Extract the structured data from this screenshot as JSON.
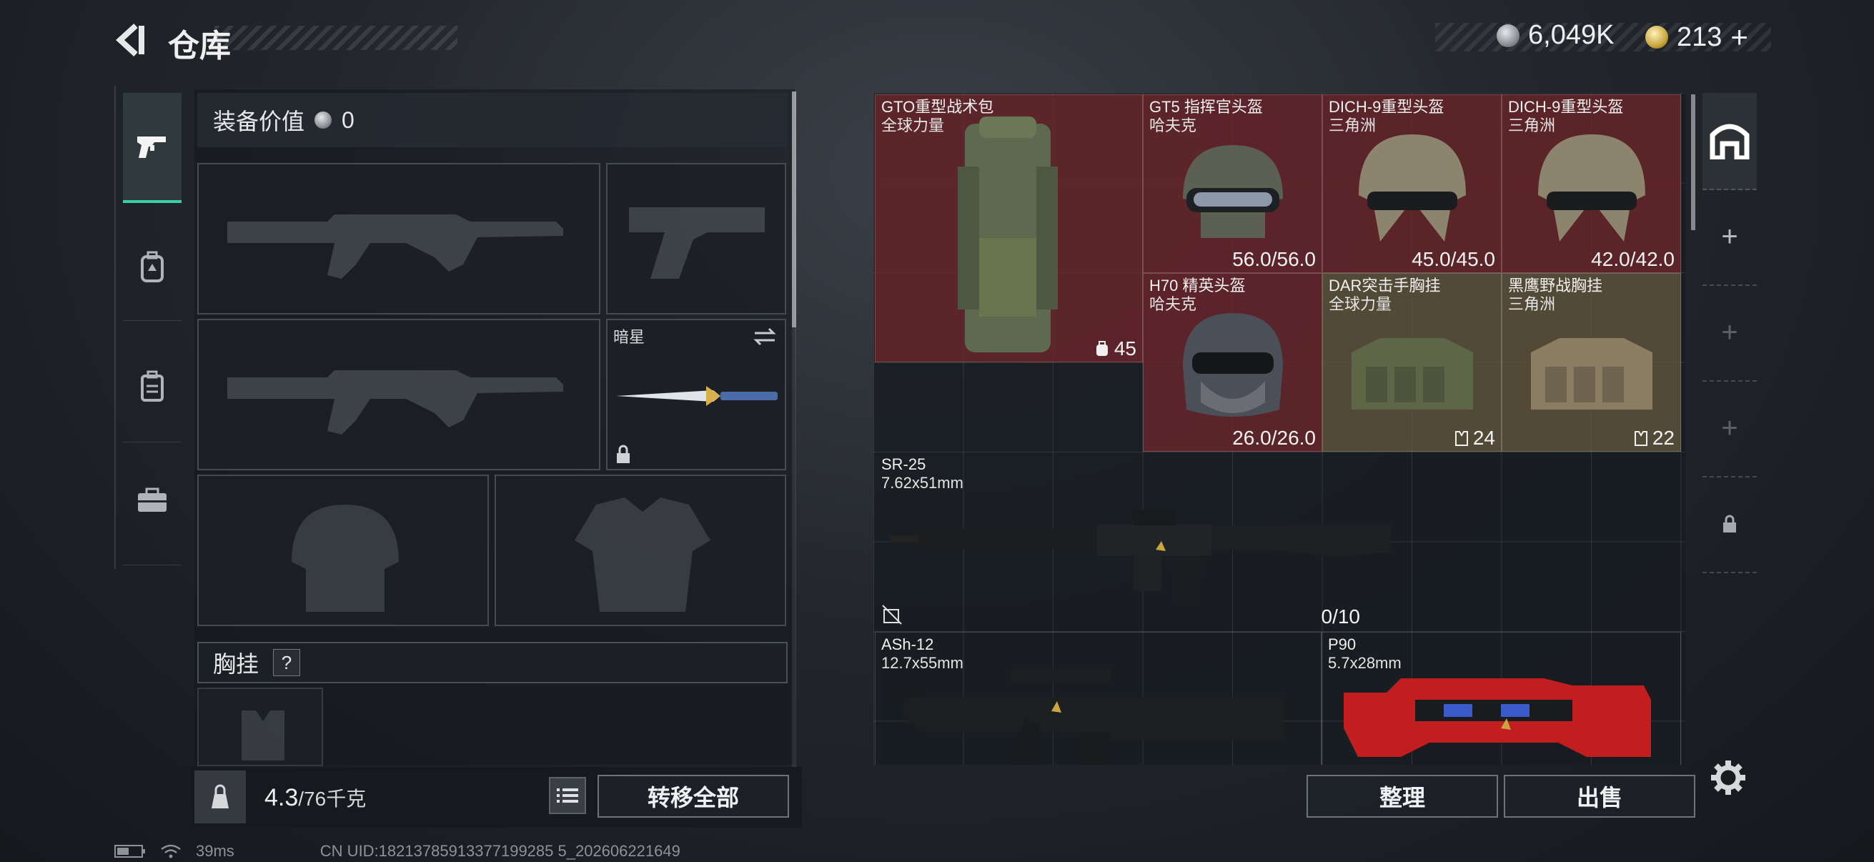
{
  "header": {
    "title": "仓库"
  },
  "currency": [
    {
      "icon": "silver-coin-icon",
      "value": "6,049K"
    },
    {
      "icon": "gold-coin-icon",
      "value": "213",
      "suffix": "+"
    }
  ],
  "left_nav": [
    {
      "icon": "pistol-icon",
      "active": true
    },
    {
      "icon": "backpack-lock-icon"
    },
    {
      "icon": "backpack-icon"
    },
    {
      "icon": "toolbox-icon"
    }
  ],
  "equipment": {
    "label": "装备价值",
    "value": "0",
    "melee_label": "暗星",
    "chest_label": "胸挂",
    "help": "?"
  },
  "footer_left": {
    "weight_value": "4.3",
    "weight_max": "/76千克",
    "transfer_all": "转移全部"
  },
  "items": [
    {
      "name": "GTO重型战术包",
      "sub": "全球力量",
      "count": "45",
      "count_icon": "backpack-small-icon",
      "rarity": "red"
    },
    {
      "name": "GT5 指挥官头盔",
      "sub": "哈夫克",
      "value": "56.0/56.0",
      "rarity": "red"
    },
    {
      "name": "DICH-9重型头盔",
      "sub": "三角洲",
      "value": "45.0/45.0",
      "rarity": "red"
    },
    {
      "name": "DICH-9重型头盔",
      "sub": "三角洲",
      "value": "42.0/42.0",
      "rarity": "red"
    },
    {
      "name": "H70 精英头盔",
      "sub": "哈夫克",
      "value": "26.0/26.0",
      "rarity": "red"
    },
    {
      "name": "DAR突击手胸挂",
      "sub": "全球力量",
      "count": "24",
      "count_icon": "vest-small-icon",
      "rarity": "olive"
    },
    {
      "name": "黑鹰野战胸挂",
      "sub": "三角洲",
      "count": "22",
      "count_icon": "vest-small-icon",
      "rarity": "olive"
    },
    {
      "name": "SR-25",
      "sub": "7.62x51mm",
      "value": "0/10",
      "rarity": "none"
    },
    {
      "name": "ASh-12",
      "sub": "12.7x55mm",
      "rarity": "none"
    },
    {
      "name": "P90",
      "sub": "5.7x28mm",
      "rarity": "none"
    }
  ],
  "footer_right": {
    "sort": "整理",
    "sell": "出售"
  },
  "status_bar": {
    "ping": "39ms",
    "uid": "CN UID:18213785913377199285 5_202606221649"
  }
}
